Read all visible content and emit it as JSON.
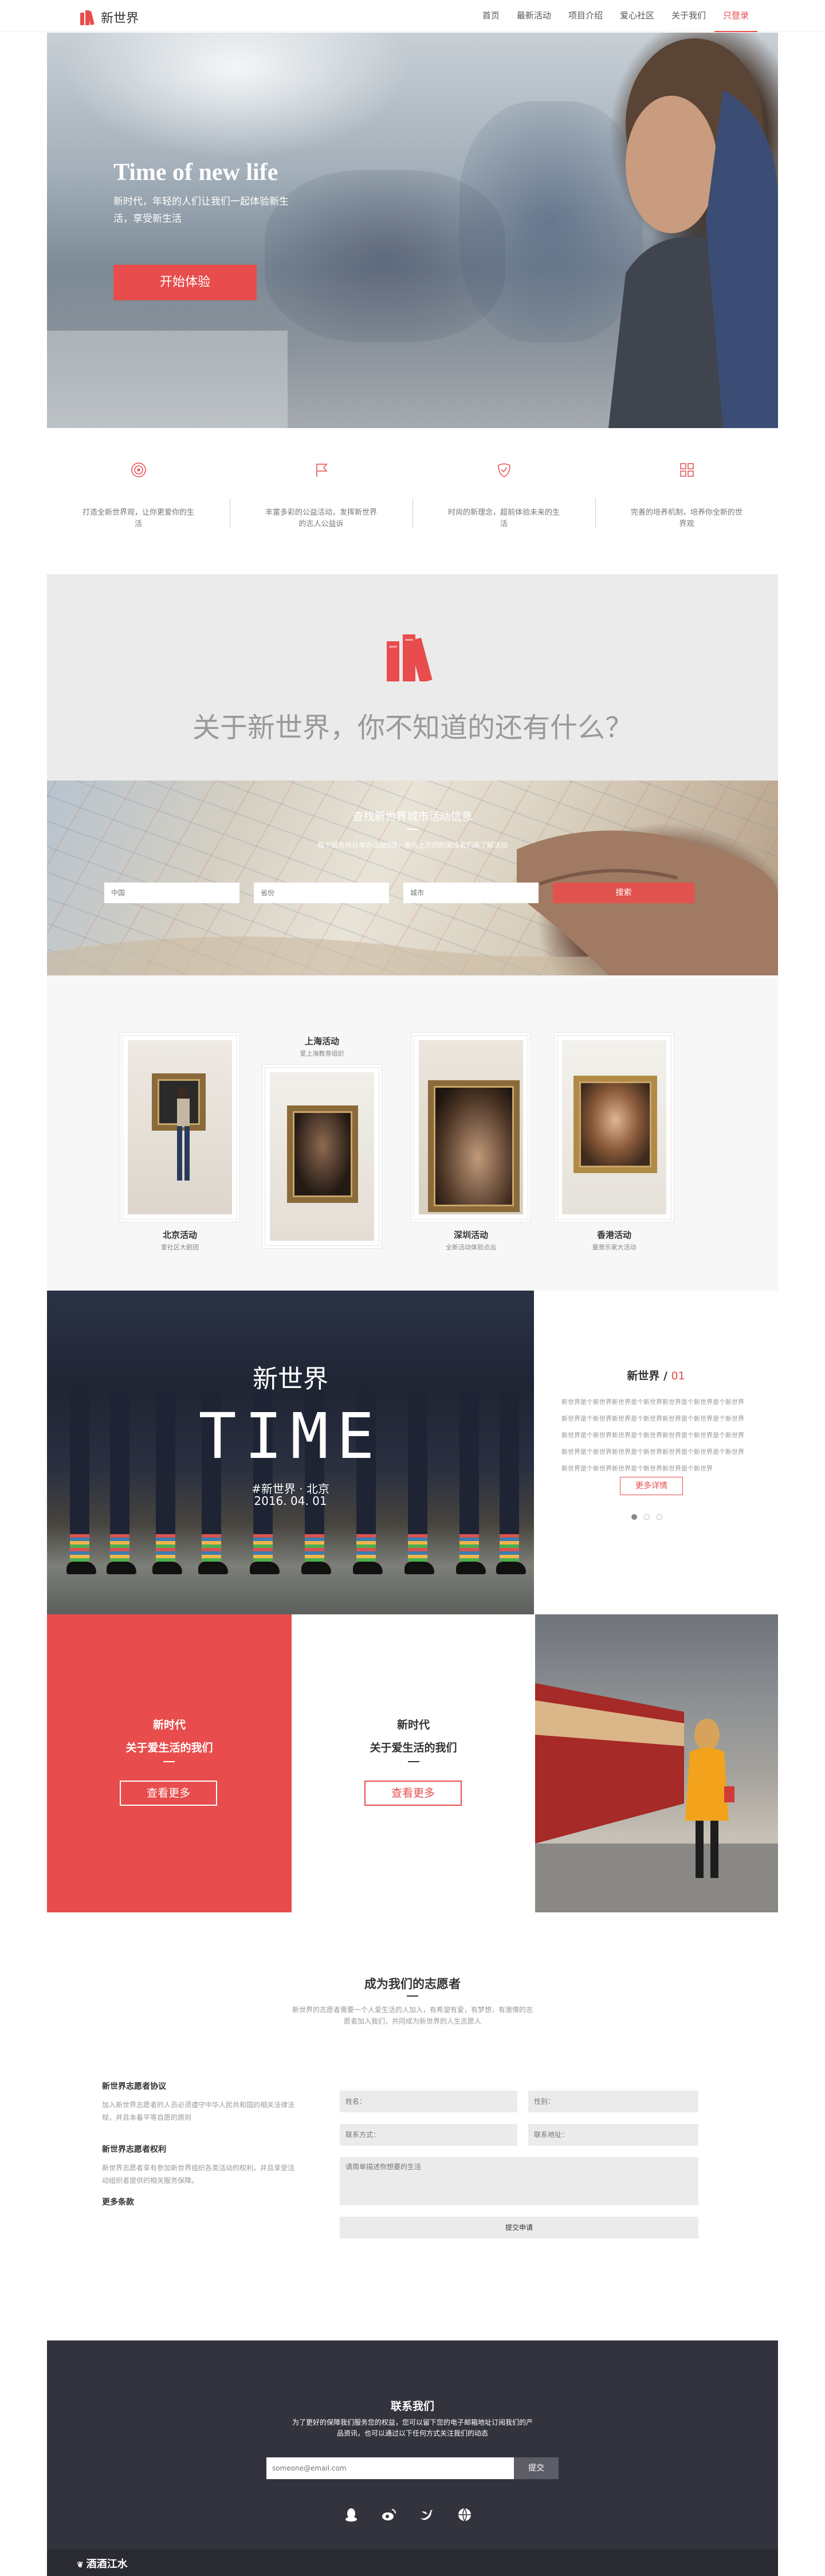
{
  "nav": {
    "brand": "新世界",
    "items": [
      {
        "label": "首页"
      },
      {
        "label": "最新活动"
      },
      {
        "label": "项目介绍"
      },
      {
        "label": "爱心社区"
      },
      {
        "label": "关于我们"
      },
      {
        "label": "只登录"
      }
    ],
    "accent": "#e84c4c"
  },
  "hero": {
    "title": "Time of new life",
    "subtitle": "新时代，年轻的人们让我们一起体验新生活，享受新生活",
    "button": "开始体验"
  },
  "features": [
    {
      "icon": "target-icon",
      "text": "打造全新世界观，让你更爱你的生活"
    },
    {
      "icon": "flag-icon",
      "text": "丰富多彩的公益活动，发挥新世界的志人公益诉"
    },
    {
      "icon": "shield-icon",
      "text": "时尚的新理念，超前体验未来的生活"
    },
    {
      "icon": "grid-icon",
      "text": "完善的培养机制，培养你全新的世界观"
    }
  ],
  "about": {
    "title": "关于新世界，你不知道的还有什么？"
  },
  "map_search": {
    "title": "查找新世界城市活动信息",
    "subtitle": "每个城市共计举办活动3场，参与上万同的阅读者们来了解活动",
    "fields": [
      {
        "placeholder": "中国"
      },
      {
        "placeholder": "省份"
      },
      {
        "placeholder": "城市"
      }
    ],
    "button": "搜索"
  },
  "events": [
    {
      "title": "北京活动",
      "sub": "爱社区大剧团"
    },
    {
      "title": "上海活动",
      "sub": "爱上海教育组织"
    },
    {
      "title": "深圳活动",
      "sub": "全新活动体验点出"
    },
    {
      "title": "香港活动",
      "sub": "童普乐家大活动"
    }
  ],
  "time_block": {
    "line1": "新世界",
    "line2": "TIME",
    "line3": "#新世界 · 北京",
    "line4": "2016. 04. 01",
    "side_title": "新世界",
    "side_sep": " / ",
    "side_num": "01",
    "paragraph_lines": [
      "新世界是个新世界新世界是个新世界新世界是个新世界是个新世界",
      "新世界是个新世界新世界是个新世界新世界是个新世界是个新世界",
      "新世界是个新世界新世界是个新世界新世界是个新世界是个新世界",
      "新世界是个新世界新世界是个新世界新世界是个新世界是个新世界",
      "新世界是个新世界新世界是个新世界新世界是个新世界"
    ],
    "button": "更多详情"
  },
  "promo": [
    {
      "line1": "新时代",
      "line2": "关于爱生活的我们",
      "button": "查看更多"
    },
    {
      "line1": "新时代",
      "line2": "关于爱生活的我们",
      "button": "查看更多"
    }
  ],
  "volunteer": {
    "title": "成为我们的志愿者",
    "subtitle": "新世界的志愿者需要一个人爱生活的人加入，有希望有爱，有梦想，有激情的志愿者加入我们，共同成为新世界的人生志愿人",
    "left": [
      {
        "heading": "新世界志愿者协议",
        "text": "加入新世界志愿者的人员必须遵守中华人民共和国的相关法律法规，并且本着平等自愿的原则"
      },
      {
        "heading": "新世界志愿者权利",
        "text": "新世界志愿者享有参加新世界组织各类活动的权利，并且享受活动组织者提供的相关服务保障。"
      },
      {
        "heading": "更多条款",
        "text": ""
      }
    ],
    "form": {
      "name": "姓名：",
      "gender": "性别：",
      "contact": "联系方式：",
      "email": "联系地址：",
      "message": "请简单描述你想要的生活",
      "submit": "提交申请"
    }
  },
  "footer": {
    "title": "联系我们",
    "subtitle": "为了更好的保障我们服务您的权益，您可以留下您的电子邮箱地址订阅我们的产品资讯，也可以通过以下任何方式关注我们的动态",
    "email_placeholder": "someone@email.com",
    "button": "提交",
    "icons": [
      "qq-icon",
      "weibo-icon",
      "twitter-icon",
      "globe-icon"
    ],
    "brand": "酒酒江水"
  }
}
